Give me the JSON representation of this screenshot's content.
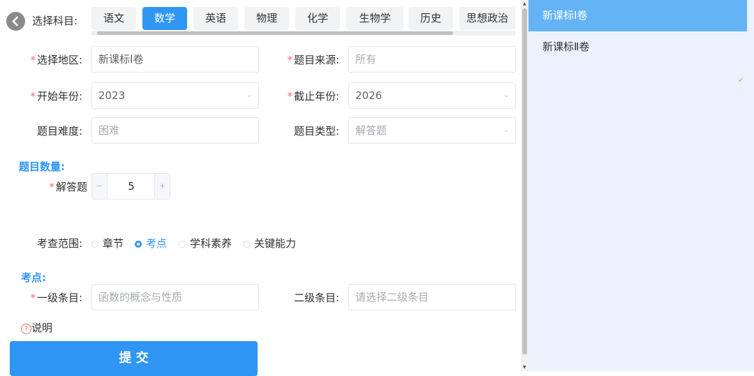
{
  "header": {
    "subject_label": "选择科目:",
    "tabs": [
      "语文",
      "数学",
      "英语",
      "物理",
      "化学",
      "生物学",
      "历史",
      "思想政治"
    ],
    "active_tab": "数学"
  },
  "form": {
    "region_label": "选择地区:",
    "region_value": "新课标Ⅰ卷",
    "source_label": "题目来源:",
    "source_placeholder": "所有",
    "start_year_label": "开始年份:",
    "start_year_value": "2023",
    "end_year_label": "截止年份:",
    "end_year_value": "2026",
    "difficulty_label": "题目难度:",
    "difficulty_placeholder": "困难",
    "type_label": "题目类型:",
    "type_placeholder": "解答题",
    "count_section": "题目数量:",
    "count_label": "解答题",
    "count_value": "5",
    "minus": "−",
    "plus": "+",
    "scope_label": "考查范围:",
    "scope_options": [
      "章节",
      "考点",
      "学科素养",
      "关键能力"
    ],
    "scope_selected": "考点",
    "point_section": "考点:",
    "level1_label": "一级条目:",
    "level1_placeholder": "函数的概念与性质",
    "level2_label": "二级条目:",
    "level2_placeholder": "请选择二级条目",
    "help_text": "说明",
    "submit_label": "提 交"
  },
  "dropdown": {
    "options": [
      "新课标Ⅰ卷",
      "新课标Ⅱ卷"
    ],
    "selected": "新课标Ⅰ卷"
  },
  "colors": {
    "accent": "#2f96f3",
    "required": "#f56c6c",
    "panel_bg": "#ebf2fd",
    "selected_option": "#64b3f4"
  }
}
